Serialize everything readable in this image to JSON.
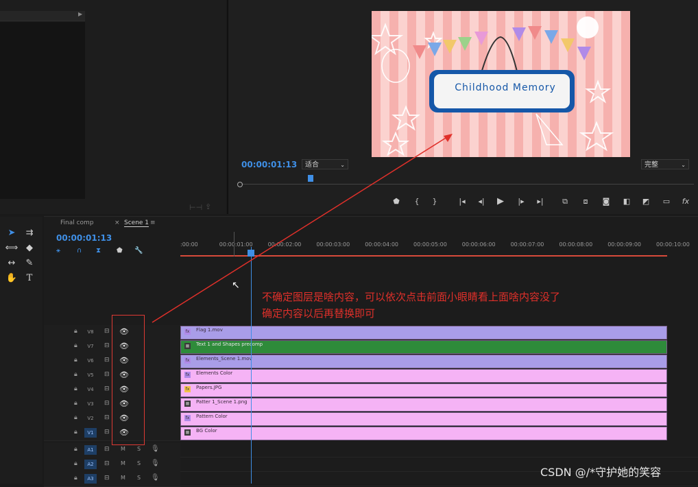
{
  "program_monitor": {
    "timecode": "00:00:01:13",
    "zoom_label": "适合",
    "quality_label": "完整",
    "video_title": "Childhood Memory",
    "controls": [
      "marker-icon",
      "in-point-icon",
      "out-point-icon",
      "goto-in-icon",
      "step-back-icon",
      "play-icon",
      "step-forward-icon",
      "goto-out-icon",
      "lift-icon",
      "extract-icon",
      "camera-icon",
      "compare-icon",
      "multicam-icon",
      "safe-margins-icon",
      "fx-icon"
    ]
  },
  "timeline": {
    "tabs": [
      "Final comp",
      "Scene 1"
    ],
    "close_glyph": "×",
    "menu_glyph": "≡",
    "timecode": "00:00:01:13",
    "ruler_ticks": [
      ":00:00",
      "00:00:01:00",
      "00:00:02:00",
      "00:00:03:00",
      "00:00:04:00",
      "00:00:05:00",
      "00:00:06:00",
      "00:00:07:00",
      "00:00:08:00",
      "00:00:09:00",
      "00:00:10:00"
    ],
    "video_tracks": [
      {
        "name": "V8",
        "clip": "Flag 1.mov",
        "color": "#a99de8",
        "fx": "fx"
      },
      {
        "name": "V7",
        "clip": "Text 1 and Shapes precomp",
        "color": "#2e8b3a",
        "fx": "■"
      },
      {
        "name": "V6",
        "clip": "Elements_Scene 1.mov",
        "color": "#a99de8",
        "fx": "fx"
      },
      {
        "name": "V5",
        "clip": "Elements Color",
        "color": "#f5b3f5",
        "fx": "fx"
      },
      {
        "name": "V4",
        "clip": "Papers.JPG",
        "color": "#f5b3f5",
        "fx": "fx"
      },
      {
        "name": "V3",
        "clip": "Patter 1_Scene 1.png",
        "color": "#f5b3f5",
        "fx": "■"
      },
      {
        "name": "V2",
        "clip": "Pattern Color",
        "color": "#f5b3f5",
        "fx": "fx"
      },
      {
        "name": "V1",
        "clip": "BG Color",
        "color": "#f5b3f5",
        "fx": "■"
      }
    ],
    "audio_tracks": [
      {
        "name": "A1",
        "m": "M",
        "s": "S"
      },
      {
        "name": "A2",
        "m": "M",
        "s": "S"
      },
      {
        "name": "A3",
        "m": "M",
        "s": "S"
      }
    ]
  },
  "annotation": {
    "line1": "不确定图层是啥内容，可以依次点击前面小眼睛看上面啥内容没了",
    "line2": "确定内容以后再替换即可",
    "color": "#e0302a"
  },
  "watermark": "CSDN @/*守护她的笑容",
  "colors": {
    "accent_blue": "#3f8fe6",
    "ruler_red": "#d84a3a"
  }
}
